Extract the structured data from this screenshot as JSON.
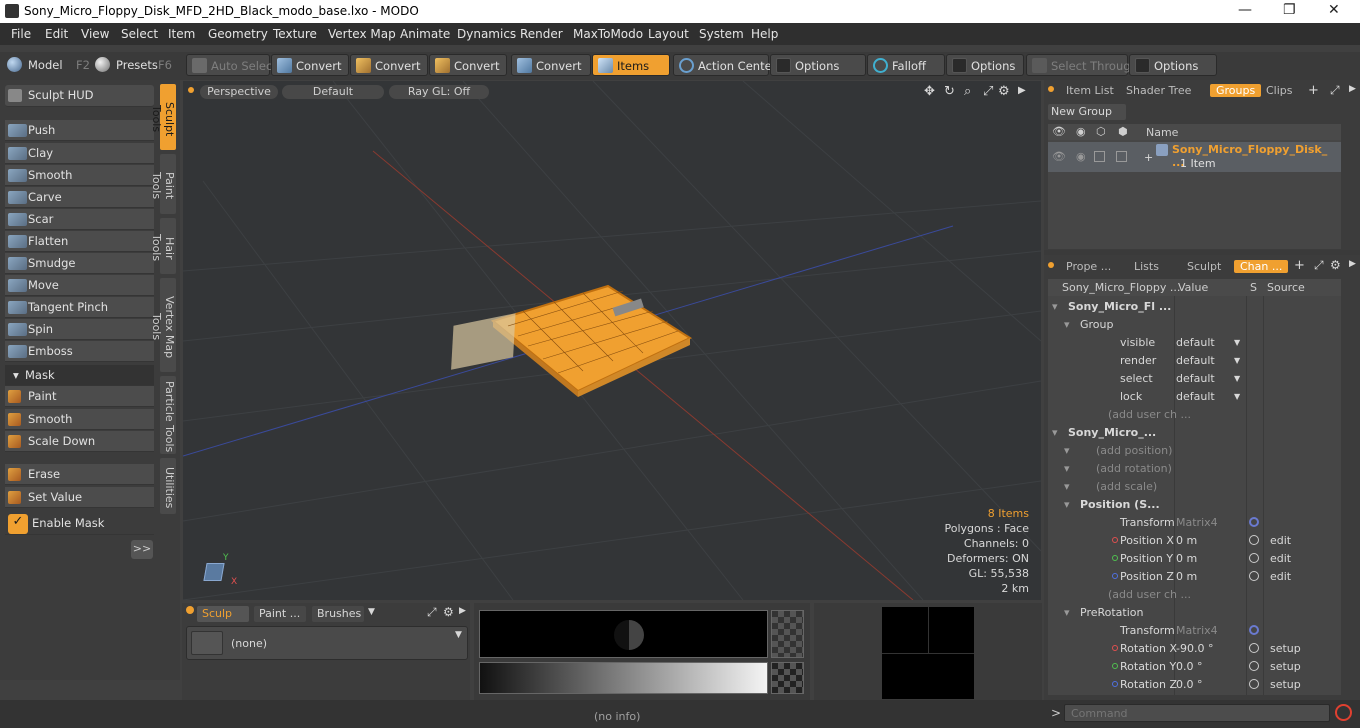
{
  "window": {
    "title": "Sony_Micro_Floppy_Disk_MFD_2HD_Black_modo_base.lxo - MODO",
    "min": "—",
    "max": "❐",
    "close": "✕"
  },
  "menu": [
    "File",
    "Edit",
    "View",
    "Select",
    "Item",
    "Geometry",
    "Texture",
    "Vertex Map",
    "Animate",
    "Dynamics",
    "Render",
    "MaxToModo",
    "Layout",
    "System",
    "Help"
  ],
  "toolbar": {
    "model": "Model",
    "model_key": "F2",
    "presets": "Presets",
    "presets_key": "F6",
    "auto_select": "Auto Select",
    "convert1": "Convert",
    "convert2": "Convert",
    "convert3": "Convert",
    "convert4": "Convert",
    "items": "Items",
    "action_center": "Action Center",
    "options1": "Options",
    "falloff": "Falloff",
    "options2": "Options",
    "select_through": "Select Through",
    "options3": "Options"
  },
  "left": {
    "sculpt_hud": "Sculpt HUD",
    "tools": [
      "Push",
      "Clay",
      "Smooth",
      "Carve",
      "Scar",
      "Flatten",
      "Smudge",
      "Move",
      "Tangent Pinch",
      "Spin",
      "Emboss"
    ],
    "mask_header": "Mask",
    "mask_tools": [
      "Paint",
      "Smooth",
      "Scale Down"
    ],
    "erase": "Erase",
    "set_value": "Set Value",
    "enable_mask": "Enable Mask",
    "expand": ">>",
    "vtabs": [
      "Sculpt Tools",
      "Paint Tools",
      "Hair Tools",
      "Vertex Map Tools",
      "Particle Tools",
      "Utilities"
    ]
  },
  "viewport": {
    "view": "Perspective",
    "shading": "Default",
    "raygl": "Ray GL: Off",
    "stats": {
      "items": "8 Items",
      "polygons": "Polygons : Face",
      "channels": "Channels: 0",
      "deformers": "Deformers: ON",
      "gl": "GL: 55,538",
      "scale": "2 km"
    },
    "axis_y": "Y",
    "axis_x": "X"
  },
  "bottom_left": {
    "tab1": "Sculp ...",
    "tab2": "Paint ...",
    "tab3": "Brushes",
    "preset": "(none)"
  },
  "status": {
    "info": "(no info)",
    "command_placeholder": "Command"
  },
  "items_panel": {
    "tabs": [
      "Item List",
      "Shader Tree",
      "Groups",
      "Clips"
    ],
    "new_group": "New Group",
    "col_name": "Name",
    "group_name": "Sony_Micro_Floppy_Disk_ ...",
    "group_count": "1 Item"
  },
  "channels_panel": {
    "tabs": [
      "Prope ...",
      "Lists",
      "Sculpt",
      "Chan ..."
    ],
    "headers": [
      "Sony_Micro_Floppy ...",
      "Value",
      "S",
      "Source"
    ],
    "rows": [
      {
        "name": "Sony_Micro_Fl ...",
        "value": "",
        "source": "",
        "bold": true,
        "indent": 1
      },
      {
        "name": "Group",
        "value": "",
        "source": "",
        "indent": 2
      },
      {
        "name": "visible",
        "value": "default",
        "source": "",
        "indent": 3,
        "drop": true
      },
      {
        "name": "render",
        "value": "default",
        "source": "",
        "indent": 3,
        "drop": true
      },
      {
        "name": "select",
        "value": "default",
        "source": "",
        "indent": 3,
        "drop": true
      },
      {
        "name": "lock",
        "value": "default",
        "source": "",
        "indent": 3,
        "drop": true
      },
      {
        "name": "(add user ch ...",
        "value": "",
        "source": "",
        "indent": 3,
        "dim": true
      },
      {
        "name": "Sony_Micro_...",
        "value": "",
        "source": "",
        "bold": true,
        "indent": 1
      },
      {
        "name": "(add position)",
        "value": "",
        "source": "",
        "indent": 2,
        "dim": true
      },
      {
        "name": "(add rotation)",
        "value": "",
        "source": "",
        "indent": 2,
        "dim": true
      },
      {
        "name": "(add scale)",
        "value": "",
        "source": "",
        "indent": 2,
        "dim": true
      },
      {
        "name": "Position (S...",
        "value": "",
        "source": "",
        "bold": true,
        "indent": 2
      },
      {
        "name": "Transform",
        "value": "Matrix4",
        "source": "",
        "indent": 3,
        "dimval": true
      },
      {
        "name": "Position X",
        "value": "0 m",
        "source": "edit",
        "indent": 3,
        "dot": "#e05050"
      },
      {
        "name": "Position Y",
        "value": "0 m",
        "source": "edit",
        "indent": 3,
        "dot": "#50c050"
      },
      {
        "name": "Position Z",
        "value": "0 m",
        "source": "edit",
        "indent": 3,
        "dot": "#5070e0"
      },
      {
        "name": "(add user ch ...",
        "value": "",
        "source": "",
        "indent": 3,
        "dim": true
      },
      {
        "name": "PreRotation",
        "value": "",
        "source": "",
        "indent": 2
      },
      {
        "name": "Transform",
        "value": "Matrix4",
        "source": "",
        "indent": 3,
        "dimval": true
      },
      {
        "name": "Rotation X",
        "value": "-90.0 °",
        "source": "setup",
        "indent": 3,
        "dot": "#e05050"
      },
      {
        "name": "Rotation Y",
        "value": "0.0 °",
        "source": "setup",
        "indent": 3,
        "dot": "#50c050"
      },
      {
        "name": "Rotation Z",
        "value": "0.0 °",
        "source": "setup",
        "indent": 3,
        "dot": "#5070e0"
      }
    ]
  },
  "colors": {
    "accent": "#f0a030",
    "viewport_bg": "#333537"
  }
}
